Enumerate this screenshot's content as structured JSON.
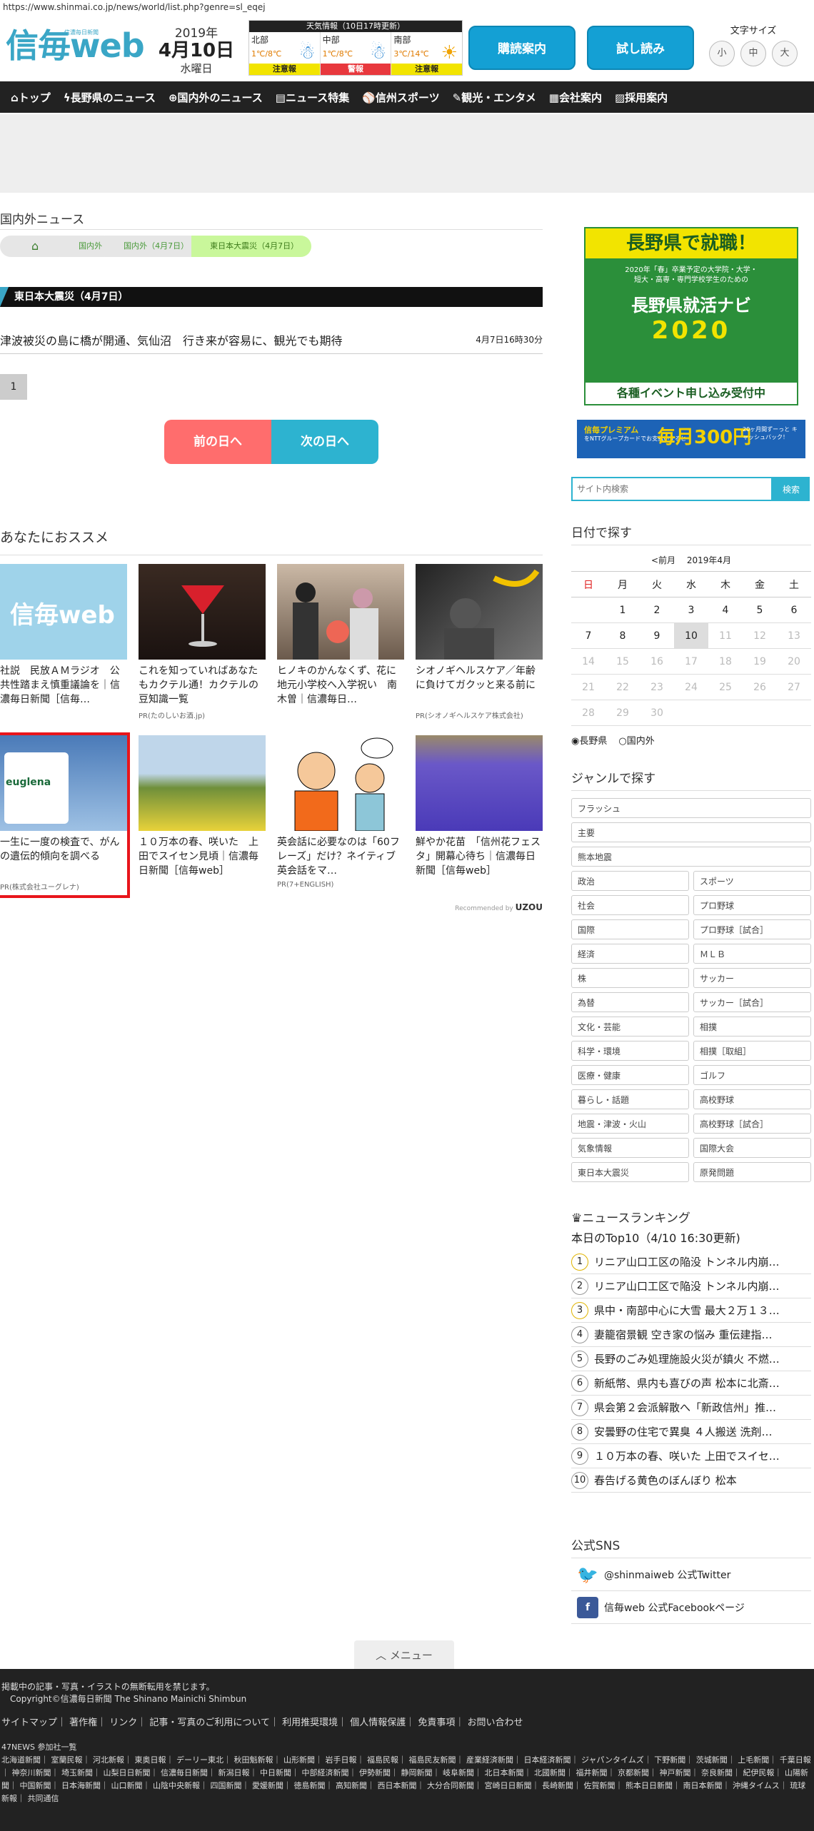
{
  "url": "https://www.shinmai.co.jp/news/world/list.php?genre=sl_eqej",
  "logo": {
    "text": "信毎web",
    "sub": "信濃毎日新聞"
  },
  "date": {
    "year": "2019年",
    "md": "4月10日",
    "weekday": "水曜日"
  },
  "weather": {
    "title": "天気情報（10日17時更新）",
    "areas": [
      {
        "name": "北部",
        "temp": "1℃/8℃",
        "alert": "注意報",
        "alert_color": "#f2e400",
        "icon": "snow-cloud-icon"
      },
      {
        "name": "中部",
        "temp": "1℃/8℃",
        "alert": "警報",
        "alert_color": "#e8383d",
        "icon": "snow-cloud-icon"
      },
      {
        "name": "南部",
        "temp": "3℃/14℃",
        "alert": "注意報",
        "alert_color": "#f2e400",
        "icon": "sun-icon"
      }
    ]
  },
  "header": {
    "subscribe": "購読案内",
    "trial": "試し読み",
    "font_label": "文字サイズ",
    "font_sizes": [
      "小",
      "中",
      "大"
    ]
  },
  "nav": [
    "トップ",
    "長野県のニュース",
    "国内外のニュース",
    "ニュース特集",
    "信州スポーツ",
    "観光・エンタメ",
    "会社案内",
    "採用案内"
  ],
  "section_title": "国内外ニュース",
  "breadcrumb": [
    "国内外",
    "国内外（4月7日）",
    "東日本大震災（4月7日）"
  ],
  "category_head": "東日本大震災（4月7日）",
  "article": {
    "title": "津波被災の島に橋が開通、気仙沼　行き来が容易に、観光でも期待",
    "date": "4月7日16時30分"
  },
  "page_num": "1",
  "day_nav": {
    "prev": "前の日へ",
    "next": "次の日へ"
  },
  "recommend": {
    "title": "あなたにおススメ",
    "by": "Recommended by",
    "by_brand": "UZOU",
    "cards": [
      {
        "text": "社説　民放ＡＭラジオ　公共性踏まえ慎重議論を｜信濃毎日新聞［信毎…",
        "pr": ""
      },
      {
        "text": "これを知っていればあなたもカクテル通！カクテルの豆知識一覧",
        "pr": "PR(たのしいお酒.jp)"
      },
      {
        "text": "ヒノキのかんなくず、花に　地元小学校へ入学祝い　南木曽｜信濃毎日…",
        "pr": ""
      },
      {
        "text": "シオノギヘルスケア／年齢に負けてガクッと来る前に",
        "pr": "PR(シオノギヘルスケア株式会社)"
      },
      {
        "text": "一生に一度の検査で、がんの遺伝的傾向を調べる",
        "pr": "PR(株式会社ユーグレナ)"
      },
      {
        "text": "１０万本の春、咲いた　上田でスイセン見頃｜信濃毎日新聞［信毎web］",
        "pr": ""
      },
      {
        "text": "英会話に必要なのは「60フレーズ」だけ？ネイティブ英会話をマ…",
        "pr": "PR(7+ENGLISH)"
      },
      {
        "text": "鮮やか花苗　「信州花フェスタ」開幕心待ち｜信濃毎日新聞［信毎web］",
        "pr": ""
      }
    ],
    "card1_logo": "信毎web",
    "card5_logo": "euglena"
  },
  "banner1": {
    "top": "長野県で就職！",
    "sub": "2020年「春」卒業予定の大学院・大学・\n短大・高専・専門学校学生のための",
    "main": "長野県就活ナビ",
    "year": "2020",
    "bottom": "各種イベント申し込み受付中"
  },
  "banner2": {
    "l": "信毎プレミアム",
    "s": "をNTTグループカードでお支払いすると",
    "r": "毎月300円",
    "c": "20ヶ月間ずーっと キャッシュバック！"
  },
  "search": {
    "placeholder": "サイト内検索",
    "button": "検索"
  },
  "calendar": {
    "title": "日付で探す",
    "nav": "<前月　 2019年4月",
    "headers": [
      "日",
      "月",
      "火",
      "水",
      "木",
      "金",
      "土"
    ],
    "weeks": [
      [
        "",
        "1",
        "2",
        "3",
        "4",
        "5",
        "6"
      ],
      [
        "7",
        "8",
        "9",
        "10",
        "11",
        "12",
        "13"
      ],
      [
        "14",
        "15",
        "16",
        "17",
        "18",
        "19",
        "20"
      ],
      [
        "21",
        "22",
        "23",
        "24",
        "25",
        "26",
        "27"
      ],
      [
        "28",
        "29",
        "30",
        "",
        "",
        "",
        ""
      ]
    ],
    "today": "10",
    "radio1": "長野県",
    "radio2": "国内外"
  },
  "genres": {
    "title": "ジャンルで探す",
    "full": [
      "フラッシュ",
      "主要",
      "熊本地震"
    ],
    "pairs": [
      "政治",
      "スポーツ",
      "社会",
      "プロ野球",
      "国際",
      "プロ野球［試合］",
      "経済",
      "ＭＬＢ",
      "株",
      "サッカー",
      "為替",
      "サッカー［試合］",
      "文化・芸能",
      "相撲",
      "科学・環境",
      "相撲［取組］",
      "医療・健康",
      "ゴルフ",
      "暮らし・話題",
      "高校野球",
      "地震・津波・火山",
      "高校野球［試合］",
      "気象情報",
      "国際大会",
      "東日本大震災",
      "原発問題"
    ]
  },
  "ranking": {
    "title": "ニュースランキング",
    "sub": "本日のTop10（4/10 16:30更新)",
    "items": [
      "リニア山口工区の陥没 トンネル内崩…",
      "リニア山口工区で陥没 トンネル内崩…",
      "県中・南部中心に大雪 最大２万１３…",
      "妻籠宿景観 空き家の悩み 重伝建指…",
      "長野のごみ処理施設火災が鎮火 不燃…",
      "新紙幣、県内も喜びの声 松本に北斎…",
      "県会第２会派解散へ「新政信州」推…",
      "安曇野の住宅で異臭 ４人搬送 洗剤…",
      "１０万本の春、咲いた 上田でスイセ…",
      "春告げる黄色のぼんぼり 松本"
    ]
  },
  "sns": {
    "title": "公式SNS",
    "twitter": "@shinmaiweb 公式Twitter",
    "facebook": "信毎web 公式Facebookページ"
  },
  "menu_tab": "メニュー",
  "footer": {
    "notice": "掲載中の記事・写真・イラストの無断転用を禁じます。",
    "copy": "Copyright©信濃毎日新聞 The Shinano Mainichi Shimbun",
    "links": "サイトマップ｜ 著作権｜ リンク｜ 記事・写真のご利用について｜ 利用推奨環境｜ 個人情報保護｜ 免責事項｜ お問い合わせ",
    "np_title": "47NEWS 参加社一覧",
    "np_list": "北海道新聞｜ 室蘭民報｜ 河北新報｜ 東奥日報｜ デーリー東北｜ 秋田魁新報｜ 山形新聞｜ 岩手日報｜ 福島民報｜ 福島民友新聞｜ 産業経済新聞｜ 日本経済新聞｜ ジャパンタイムズ｜ 下野新聞｜ 茨城新聞｜ 上毛新聞｜ 千葉日報｜ 神奈川新聞｜ 埼玉新聞｜ 山梨日日新聞｜ 信濃毎日新聞｜ 新潟日報｜ 中日新聞｜ 中部経済新聞｜ 伊勢新聞｜ 静岡新聞｜ 岐阜新聞｜ 北日本新聞｜ 北國新聞｜ 福井新聞｜ 京都新聞｜ 神戸新聞｜ 奈良新聞｜ 紀伊民報｜ 山陽新聞｜ 中国新聞｜ 日本海新聞｜ 山口新聞｜ 山陰中央新報｜ 四国新聞｜ 愛媛新聞｜ 徳島新聞｜ 高知新聞｜ 西日本新聞｜ 大分合同新聞｜ 宮崎日日新聞｜ 長崎新聞｜ 佐賀新聞｜ 熊本日日新聞｜ 南日本新聞｜ 沖縄タイムス｜ 琉球新報｜ 共同通信"
  }
}
